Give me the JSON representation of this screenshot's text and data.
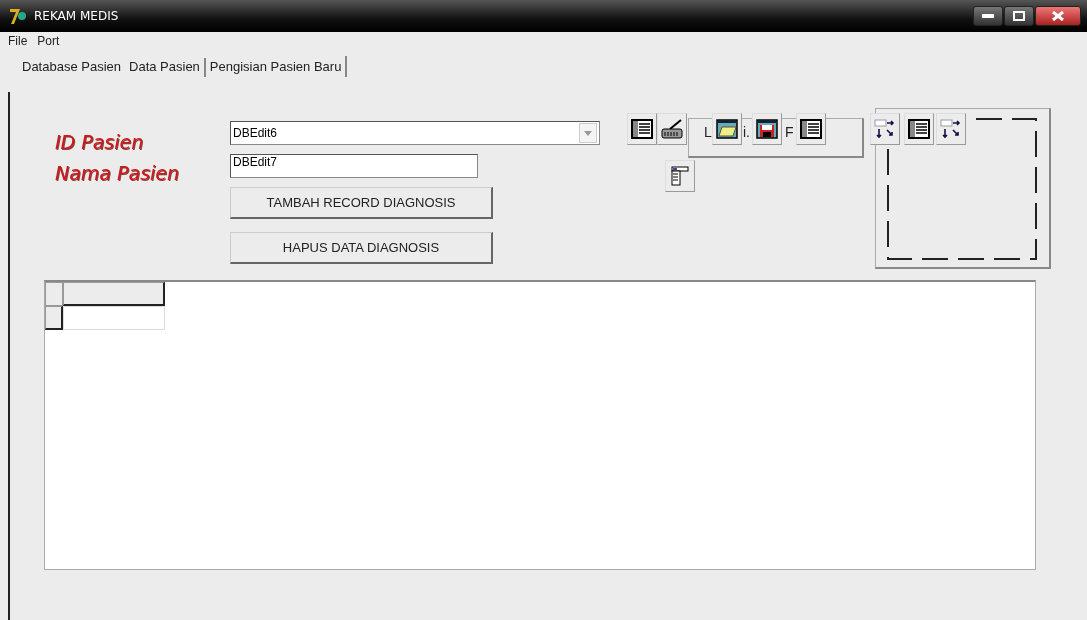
{
  "window": {
    "title": "REKAM MEDIS"
  },
  "menu": [
    "File",
    "Port"
  ],
  "tabs": [
    {
      "label": "Database Pasien",
      "selected": false
    },
    {
      "label": "Data Pasien",
      "selected": true
    },
    {
      "label": "Pengisian Pasien Baru",
      "selected": false
    }
  ],
  "form": {
    "fields": [
      {
        "label": "ID Pasien",
        "value": "DBEdit6",
        "kind": "combo"
      },
      {
        "label": "Nama Pasien",
        "value": "DBEdit7",
        "kind": "edit"
      }
    ],
    "buttons": [
      "TAMBAH RECORD DIAGNOSIS",
      "HAPUS DATA DIAGNOSIS"
    ],
    "component_captions": [
      "L",
      "i.",
      "F"
    ]
  }
}
